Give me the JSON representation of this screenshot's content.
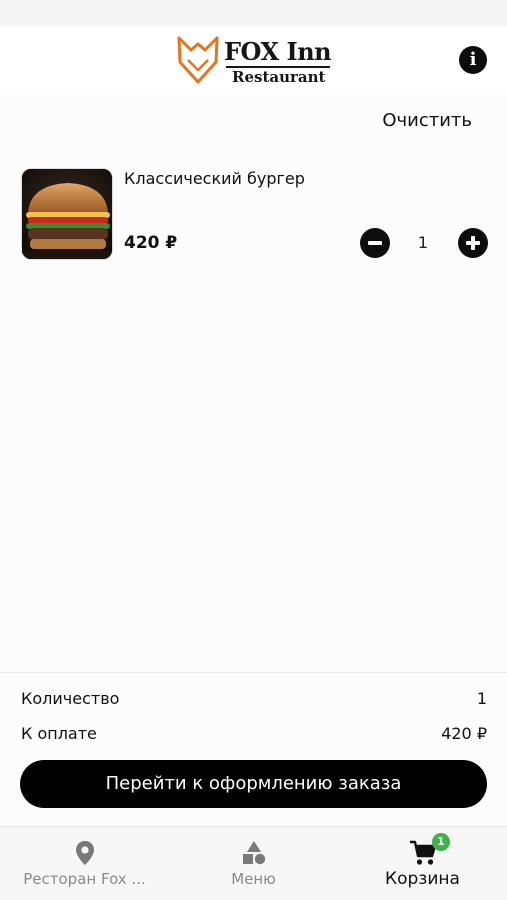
{
  "brand": {
    "name_line1": "FOX Inn",
    "name_line2": "Restaurant",
    "accent_color": "#e8731c"
  },
  "header": {
    "info_icon": "info-icon",
    "info_glyph": "i"
  },
  "cart": {
    "clear_label": "Очистить",
    "items": [
      {
        "title": "Классический бургер",
        "price": "420 ₽",
        "quantity": "1",
        "image": "burger-photo"
      }
    ]
  },
  "summary": {
    "quantity_label": "Количество",
    "quantity_value": "1",
    "total_label": "К оплате",
    "total_value": "420 ₽",
    "checkout_label": "Перейти к оформлению заказа"
  },
  "tabbar": {
    "tabs": [
      {
        "label": "Ресторан Fox ...",
        "icon": "location-pin-icon",
        "active": false
      },
      {
        "label": "Меню",
        "icon": "shapes-icon",
        "active": false
      },
      {
        "label": "Корзина",
        "icon": "cart-icon",
        "active": true,
        "badge": "1"
      }
    ],
    "badge_color": "#3fb24a"
  }
}
